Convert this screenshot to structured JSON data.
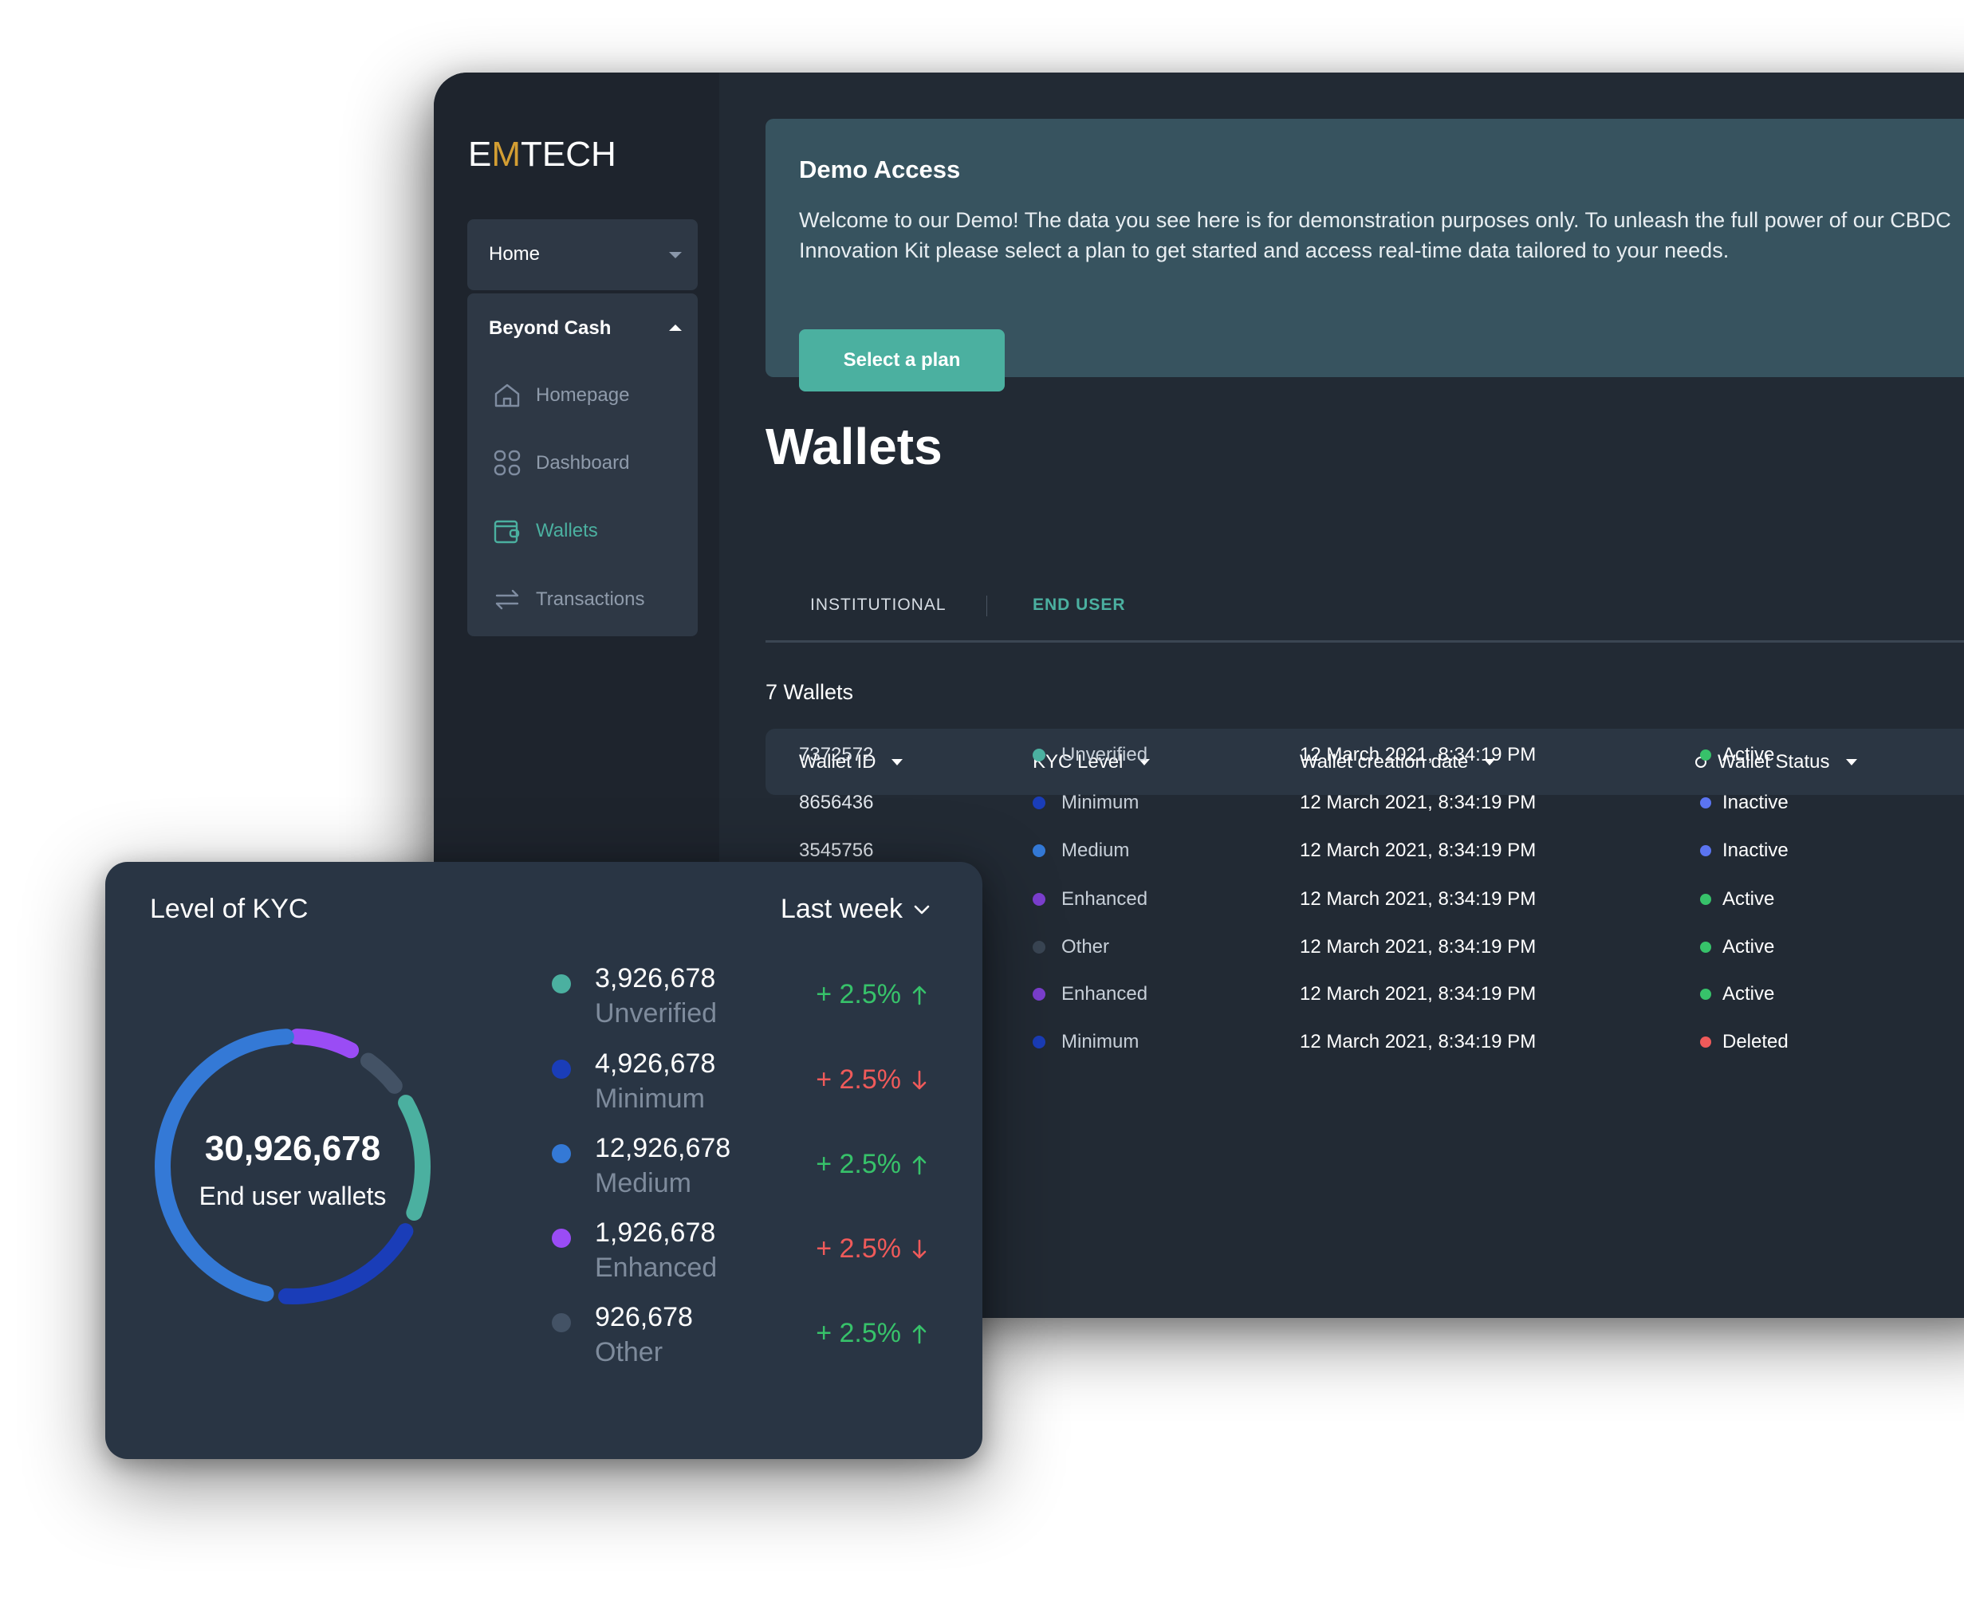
{
  "brand": {
    "prefix": "E",
    "accent": "M",
    "suffix": "TECH",
    "accent_color": "#d39e33"
  },
  "sidebar": {
    "home": {
      "label": "Home",
      "icon": "caret-down-icon"
    },
    "section": {
      "label": "Beyond Cash",
      "icon": "caret-up-icon"
    },
    "items": [
      {
        "label": "Homepage",
        "icon": "home-icon",
        "active": false
      },
      {
        "label": "Dashboard",
        "icon": "grid-icon",
        "active": false
      },
      {
        "label": "Wallets",
        "icon": "wallet-icon",
        "active": true
      },
      {
        "label": "Transactions",
        "icon": "transfer-icon",
        "active": false
      }
    ]
  },
  "banner": {
    "title": "Demo Access",
    "text": "Welcome to our Demo! The data you see here is for demonstration purposes only. To unleash the full power of our CBDC Innovation Kit please select a plan to get started and access real-time data tailored to your needs.",
    "button": "Select a plan"
  },
  "page": {
    "title": "Wallets",
    "tabs": [
      {
        "label": "INSTITUTIONAL",
        "active": false
      },
      {
        "label": "END USER",
        "active": true
      }
    ],
    "count": "7 Wallets"
  },
  "table": {
    "columns": [
      "Wallet ID",
      "KYC Level",
      "Wallet creation date",
      "Wallet Status"
    ],
    "rows": [
      {
        "id": "7372572",
        "kyc": "Unverified",
        "kyc_color": "#4bb0a0",
        "date": "12 March 2021, 8:34:19 PM",
        "status": "Active",
        "status_color": "#37c26a"
      },
      {
        "id": "8656436",
        "kyc": "Minimum",
        "kyc_color": "#1a3db8",
        "date": "12 March 2021, 8:34:19 PM",
        "status": "Inactive",
        "status_color": "#5b74f0"
      },
      {
        "id": "3545756",
        "kyc": "Medium",
        "kyc_color": "#3479d6",
        "date": "12 March 2021, 8:34:19 PM",
        "status": "Inactive",
        "status_color": "#5b74f0"
      },
      {
        "id": "",
        "kyc": "Enhanced",
        "kyc_color": "#7c3fd0",
        "date": "12 March 2021, 8:34:19 PM",
        "status": "Active",
        "status_color": "#37c26a"
      },
      {
        "id": "",
        "kyc": "Other",
        "kyc_color": "#3a4654",
        "date": "12 March 2021, 8:34:19 PM",
        "status": "Active",
        "status_color": "#37c26a"
      },
      {
        "id": "",
        "kyc": "Enhanced",
        "kyc_color": "#7c3fd0",
        "date": "12 March 2021, 8:34:19 PM",
        "status": "Active",
        "status_color": "#37c26a"
      },
      {
        "id": "",
        "kyc": "Minimum",
        "kyc_color": "#1a3db8",
        "date": "12 March 2021, 8:34:19 PM",
        "status": "Deleted",
        "status_color": "#ef5a5a"
      }
    ]
  },
  "kyc_card": {
    "title": "Level of KYC",
    "range": "Last week",
    "total": "30,926,678",
    "total_label": "End user wallets",
    "legend": [
      {
        "value": "3,926,678",
        "name": "Unverified",
        "color": "#4bb0a0",
        "change": "+ 2.5%",
        "direction": "up"
      },
      {
        "value": "4,926,678",
        "name": "Minimum",
        "color": "#1a3db8",
        "change": "+ 2.5%",
        "direction": "down"
      },
      {
        "value": "12,926,678",
        "name": "Medium",
        "color": "#3479d6",
        "change": "+ 2.5%",
        "direction": "up"
      },
      {
        "value": "1,926,678",
        "name": "Enhanced",
        "color": "#9a4cf5",
        "change": "+ 2.5%",
        "direction": "down"
      },
      {
        "value": "926,678",
        "name": "Other",
        "color": "#435265",
        "change": "+ 2.5%",
        "direction": "up"
      }
    ]
  },
  "chart_data": {
    "type": "pie",
    "title": "Level of KYC",
    "center_value": "30,926,678",
    "center_label": "End user wallets",
    "categories": [
      "Enhanced",
      "Other",
      "Unverified",
      "Minimum",
      "Medium"
    ],
    "values": [
      1926678,
      926678,
      3926678,
      4926678,
      12926678
    ],
    "colors": [
      "#9a4cf5",
      "#435265",
      "#4bb0a0",
      "#1a3db8",
      "#3479d6"
    ]
  }
}
